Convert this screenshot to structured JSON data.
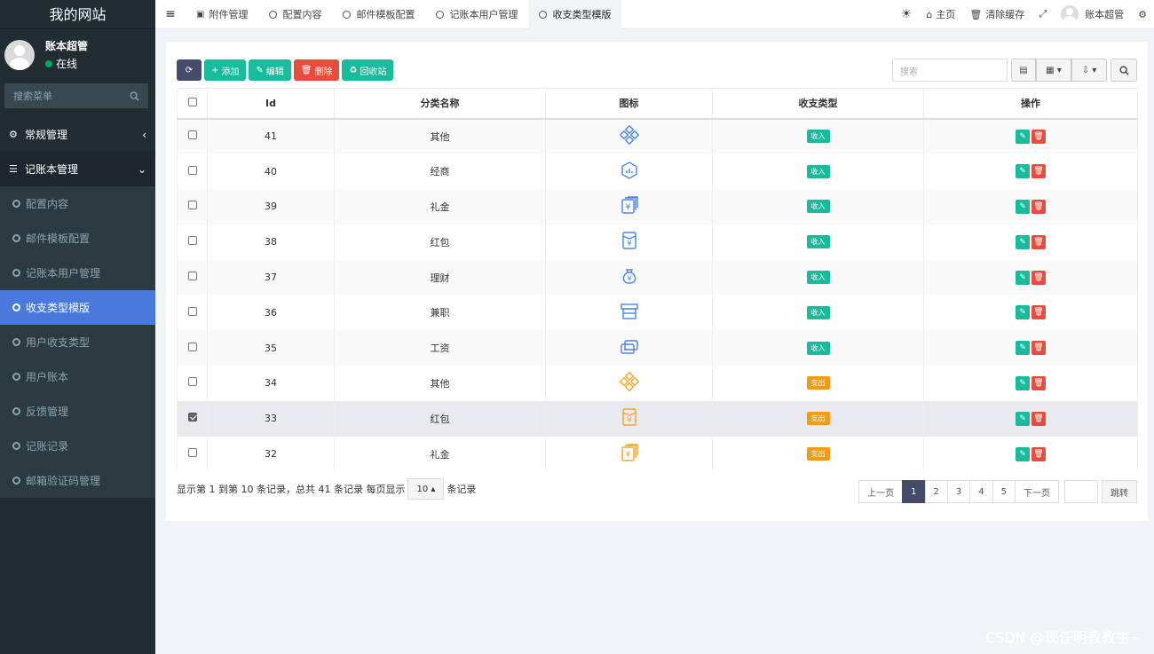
{
  "sidebar": {
    "logo": "我的网站",
    "user_name": "账本超管",
    "user_status": "在线",
    "search_placeholder": "搜索菜单",
    "groups": [
      {
        "label": "常规管理",
        "icon": "cogs-icon"
      },
      {
        "label": "记账本管理",
        "icon": "list-icon"
      }
    ],
    "sub_items": [
      {
        "label": "配置内容"
      },
      {
        "label": "邮件模板配置"
      },
      {
        "label": "记账本用户管理"
      },
      {
        "label": "收支类型模版"
      },
      {
        "label": "用户收支类型"
      },
      {
        "label": "用户账本"
      },
      {
        "label": "反馈管理"
      },
      {
        "label": "记账记录"
      },
      {
        "label": "邮箱验证码管理"
      }
    ]
  },
  "topbar": {
    "tabs": [
      "附件管理",
      "配置内容",
      "邮件模板配置",
      "记账本用户管理",
      "收支类型模版"
    ],
    "home": "主页",
    "clear_cache": "清除缓存",
    "user": "账本超管"
  },
  "toolbar": {
    "add": "添加",
    "edit": "编辑",
    "delete": "删除",
    "recycle": "回收站",
    "search_placeholder": "搜索"
  },
  "table": {
    "headers": [
      "Id",
      "分类名称",
      "图标",
      "收支类型",
      "操作"
    ],
    "rows": [
      {
        "id": "41",
        "name": "其他",
        "icon": "diamond-grid-icon",
        "type": "收入",
        "checked": false
      },
      {
        "id": "40",
        "name": "经商",
        "icon": "hexagon-chart-icon",
        "type": "收入",
        "checked": false
      },
      {
        "id": "39",
        "name": "礼金",
        "icon": "yen-cards-icon",
        "type": "收入",
        "checked": false
      },
      {
        "id": "38",
        "name": "红包",
        "icon": "red-envelope-icon",
        "type": "收入",
        "checked": false
      },
      {
        "id": "37",
        "name": "理财",
        "icon": "money-bag-icon",
        "type": "收入",
        "checked": false
      },
      {
        "id": "36",
        "name": "兼职",
        "icon": "shop-icon",
        "type": "收入",
        "checked": false
      },
      {
        "id": "35",
        "name": "工资",
        "icon": "wallet-card-icon",
        "type": "收入",
        "checked": false
      },
      {
        "id": "34",
        "name": "其他",
        "icon": "diamond-grid-icon",
        "type": "支出",
        "checked": false
      },
      {
        "id": "33",
        "name": "红包",
        "icon": "red-envelope-icon",
        "type": "支出",
        "checked": true
      },
      {
        "id": "32",
        "name": "礼金",
        "icon": "yen-cards-icon",
        "type": "支出",
        "checked": false
      }
    ]
  },
  "pagination": {
    "info": "显示第 1 到第 10 条记录，总共 41 条记录 每页显示",
    "page_size": "10",
    "suffix": "条记录",
    "prev": "上一页",
    "pages": [
      "1",
      "2",
      "3",
      "4",
      "5"
    ],
    "next": "下一页",
    "go": "跳转"
  },
  "colors": {
    "income": "#18bc9c",
    "expense": "#f39c12",
    "icon_blue": "#4a86e8",
    "icon_orange": "#f5a623"
  },
  "watermark": "CSDN @现任明教教主~"
}
